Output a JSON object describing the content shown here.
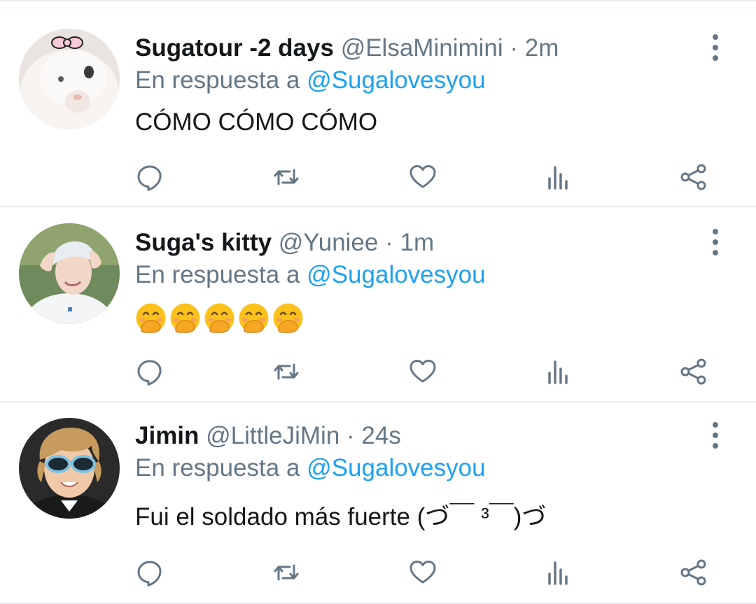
{
  "tweets": [
    {
      "name": "Sugatour -2 days",
      "handle": "@ElsaMinimini",
      "separator": "·",
      "time": "2m",
      "reply_prefix": "En respuesta a",
      "reply_to": "@Sugalovesyou",
      "text": "CÓMO CÓMO CÓMO",
      "avatar_icon": "white-kitten-avatar"
    },
    {
      "name": "Suga's kitty",
      "handle": "@Yuniee",
      "separator": "·",
      "time": "1m",
      "reply_prefix": "En respuesta a",
      "reply_to": "@Sugalovesyou",
      "text": "🤭🤭🤭🤭🤭",
      "avatar_icon": "person-white-hair-avatar"
    },
    {
      "name": "Jimin",
      "handle": "@LittleJiMin",
      "separator": "·",
      "time": "24s",
      "reply_prefix": "En respuesta a",
      "reply_to": "@Sugalovesyou",
      "text": "Fui el soldado más fuerte (づ￣ ³￣)づ",
      "avatar_icon": "person-sunglasses-avatar"
    }
  ],
  "colors": {
    "secondary_text": "#657786",
    "mention": "#1da1f2",
    "divider": "#e6ecf0"
  },
  "icons": [
    "reply-icon",
    "retweet-icon",
    "like-icon",
    "analytics-icon",
    "share-icon",
    "more-icon"
  ]
}
